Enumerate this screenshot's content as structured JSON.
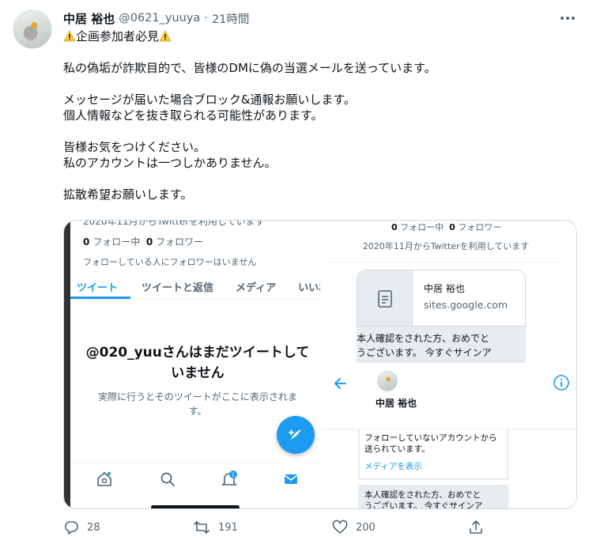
{
  "tweet": {
    "display_name": "中居 裕也",
    "handle": "@0621_yuuya",
    "separator": "·",
    "time": "21時間",
    "headline": "企画参加者必見",
    "lines": [
      "私の偽垢が詐欺目的で、皆様のDMに偽の当選メールを送っています。",
      "",
      "メッセージが届いた場合ブロック&通報お願いします。",
      "個人情報などを抜き取られる可能性があります。",
      "",
      "皆様お気をつけください。",
      "私のアカウントは一つしかありません。",
      "",
      "拡散希望お願いします。"
    ]
  },
  "left_shot": {
    "cut_top": "2020年11月からTwitterを利用しています",
    "following_count": "0",
    "following_label": "フォロー中",
    "followers_count": "0",
    "followers_label": "フォロワー",
    "followers_note": "フォローしている人にフォロワーはいません",
    "tabs": [
      "ツイート",
      "ツイートと返信",
      "メディア",
      "いいね"
    ],
    "empty_title": "@020_yuuさんはまだツイートしていません",
    "empty_sub": "実際に行うとそのツイートがここに表示されます。",
    "notification_badge": "1"
  },
  "right_shot": {
    "following_count": "0",
    "following_label": "フォロー中",
    "followers_count": "0",
    "followers_label": "フォロワー",
    "since": "2020年11月からTwitterを利用しています",
    "card_title": "中居 裕也",
    "card_url": "sites.google.com",
    "message1": [
      "本人確認をされた方、おめでと",
      "うございます。 今すぐサインア"
    ],
    "dm_name": "中居 裕也",
    "message2": "フォローしていないアカウントから送られています。",
    "message2_link": "メディアを表示",
    "message3": [
      "本人確認をされた方、おめでと",
      "うございます。 今すぐサインア"
    ]
  },
  "actions": {
    "reply_count": "28",
    "retweet_count": "191",
    "like_count": "200"
  },
  "icons": {
    "more": "more-icon",
    "reply": "reply-icon",
    "retweet": "retweet-icon",
    "like": "heart-icon",
    "share": "share-icon",
    "warning": "warning-icon"
  },
  "colors": {
    "accent": "#1d9bf0",
    "text": "#0f1419",
    "secondary": "#536471"
  }
}
